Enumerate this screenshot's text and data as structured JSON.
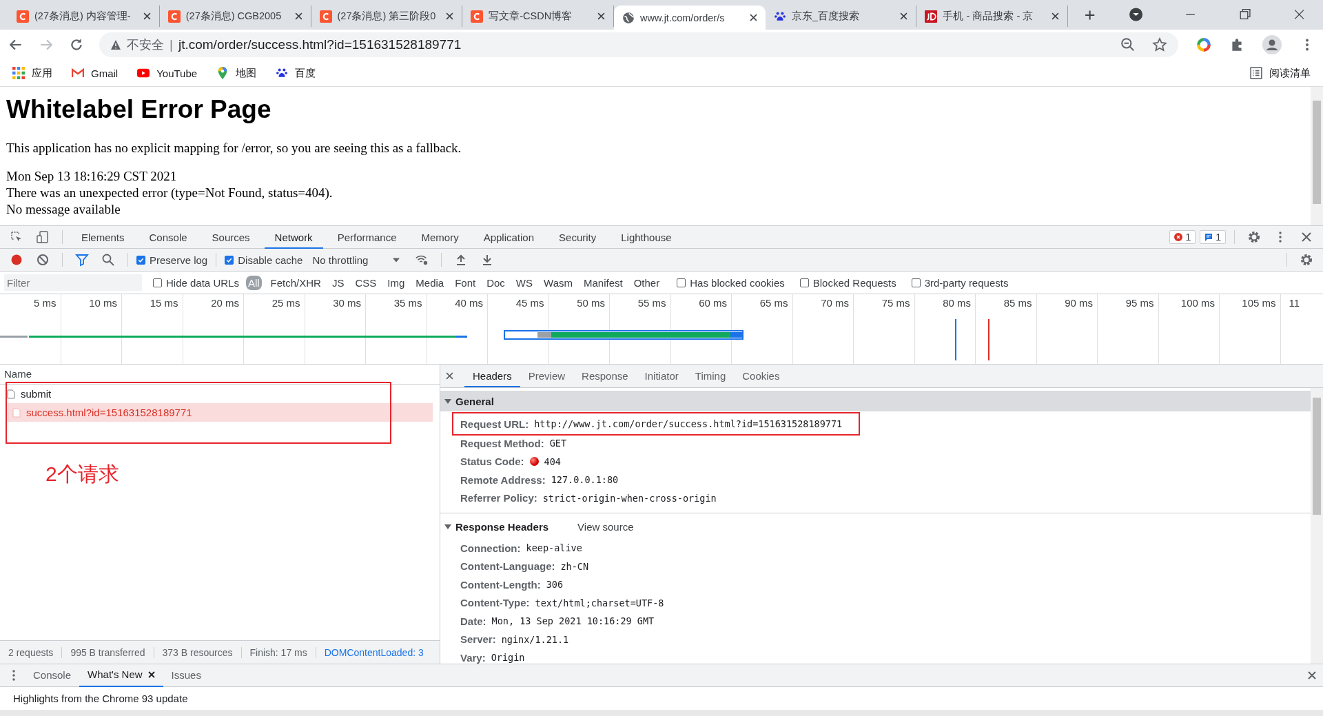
{
  "browser": {
    "tabs": [
      {
        "title": "(27条消息) 内容管理-",
        "selected": false
      },
      {
        "title": "(27条消息) CGB2005",
        "selected": false
      },
      {
        "title": "(27条消息) 第三阶段0",
        "selected": false
      },
      {
        "title": "写文章-CSDN博客",
        "selected": false
      },
      {
        "title": "www.jt.com/order/s",
        "selected": true
      },
      {
        "title": "京东_百度搜索",
        "selected": false
      },
      {
        "title": "手机 - 商品搜索 - 京",
        "selected": false
      }
    ],
    "security": "不安全",
    "separator": "|",
    "url": "jt.com/order/success.html?id=151631528189771",
    "bookmarks": [
      {
        "label": "应用"
      },
      {
        "label": "Gmail"
      },
      {
        "label": "YouTube"
      },
      {
        "label": "地图"
      },
      {
        "label": "百度"
      }
    ],
    "reading_list": "阅读清单"
  },
  "page": {
    "title": "Whitelabel Error Page",
    "paragraph": "This application has no explicit mapping for /error, so you are seeing this as a fallback.",
    "details": [
      "Mon Sep 13 18:16:29 CST 2021",
      "There was an unexpected error (type=Not Found, status=404).",
      "No message available"
    ]
  },
  "devtools": {
    "panels": [
      {
        "label": "Elements",
        "selected": false
      },
      {
        "label": "Console",
        "selected": false
      },
      {
        "label": "Sources",
        "selected": false
      },
      {
        "label": "Network",
        "selected": true
      },
      {
        "label": "Performance",
        "selected": false
      },
      {
        "label": "Memory",
        "selected": false
      },
      {
        "label": "Application",
        "selected": false
      },
      {
        "label": "Security",
        "selected": false
      },
      {
        "label": "Lighthouse",
        "selected": false
      }
    ],
    "error_count": "1",
    "message_count": "1",
    "recording": true,
    "preserve_log": {
      "label": "Preserve log",
      "checked": true
    },
    "disable_cache": {
      "label": "Disable cache",
      "checked": true
    },
    "throttling": "No throttling",
    "filter_placeholder": "Filter",
    "hide_data_urls": {
      "label": "Hide data URLs",
      "checked": false
    },
    "types": [
      {
        "label": "All",
        "selected": true
      },
      {
        "label": "Fetch/XHR",
        "selected": false
      },
      {
        "label": "JS",
        "selected": false
      },
      {
        "label": "CSS",
        "selected": false
      },
      {
        "label": "Img",
        "selected": false
      },
      {
        "label": "Media",
        "selected": false
      },
      {
        "label": "Font",
        "selected": false
      },
      {
        "label": "Doc",
        "selected": false
      },
      {
        "label": "WS",
        "selected": false
      },
      {
        "label": "Wasm",
        "selected": false
      },
      {
        "label": "Manifest",
        "selected": false
      },
      {
        "label": "Other",
        "selected": false
      }
    ],
    "options": [
      {
        "label": "Has blocked cookies",
        "checked": false
      },
      {
        "label": "Blocked Requests",
        "checked": false
      },
      {
        "label": "3rd-party requests",
        "checked": false
      }
    ],
    "timeline_ticks": [
      "5 ms",
      "10 ms",
      "15 ms",
      "20 ms",
      "25 ms",
      "30 ms",
      "35 ms",
      "40 ms",
      "45 ms",
      "50 ms",
      "55 ms",
      "60 ms",
      "65 ms",
      "70 ms",
      "75 ms",
      "80 ms",
      "85 ms",
      "90 ms",
      "95 ms",
      "100 ms",
      "105 ms",
      "11"
    ],
    "name_column": "Name",
    "requests": [
      {
        "name": "submit",
        "failed": false,
        "selected": false
      },
      {
        "name": "success.html?id=151631528189771",
        "failed": true,
        "selected": true
      }
    ],
    "detail_tabs": [
      {
        "label": "Headers",
        "selected": true
      },
      {
        "label": "Preview",
        "selected": false
      },
      {
        "label": "Response",
        "selected": false
      },
      {
        "label": "Initiator",
        "selected": false
      },
      {
        "label": "Timing",
        "selected": false
      },
      {
        "label": "Cookies",
        "selected": false
      }
    ],
    "general": {
      "title": "General",
      "expanded": true,
      "fields": [
        {
          "key": "Request URL:",
          "value": "http://www.jt.com/order/success.html?id=151631528189771",
          "highlighted": true
        },
        {
          "key": "Request Method:",
          "value": "GET",
          "highlighted": false
        },
        {
          "key": "Status Code:",
          "value": "404",
          "highlighted": false,
          "kind": "status"
        },
        {
          "key": "Remote Address:",
          "value": "127.0.0.1:80",
          "highlighted": false
        },
        {
          "key": "Referrer Policy:",
          "value": "strict-origin-when-cross-origin",
          "highlighted": false
        }
      ]
    },
    "response_headers": {
      "title": "Response Headers",
      "expanded": true,
      "view_source": "View source",
      "fields": [
        {
          "key": "Connection:",
          "value": "keep-alive"
        },
        {
          "key": "Content-Language:",
          "value": "zh-CN"
        },
        {
          "key": "Content-Length:",
          "value": "306"
        },
        {
          "key": "Content-Type:",
          "value": "text/html;charset=UTF-8"
        },
        {
          "key": "Date:",
          "value": "Mon, 13 Sep 2021 10:16:29 GMT"
        },
        {
          "key": "Server:",
          "value": "nginx/1.21.1"
        },
        {
          "key": "Vary:",
          "value": "Origin"
        }
      ]
    },
    "status_bar": [
      {
        "text": "2 requests",
        "kind": "plain"
      },
      {
        "text": "995 B transferred",
        "kind": "plain"
      },
      {
        "text": "373 B resources",
        "kind": "plain"
      },
      {
        "text": "Finish: 17 ms",
        "kind": "plain"
      },
      {
        "text": "DOMContentLoaded: 3",
        "kind": "link"
      }
    ],
    "drawer_tabs": [
      {
        "label": "Console",
        "selected": false,
        "closable": false
      },
      {
        "label": "What's New",
        "selected": true,
        "closable": true
      },
      {
        "label": "Issues",
        "selected": false,
        "closable": false
      }
    ],
    "drawer_text": "Highlights from the Chrome 93 update"
  },
  "annotation": {
    "label": "2个请求",
    "boxed_requests": true
  }
}
